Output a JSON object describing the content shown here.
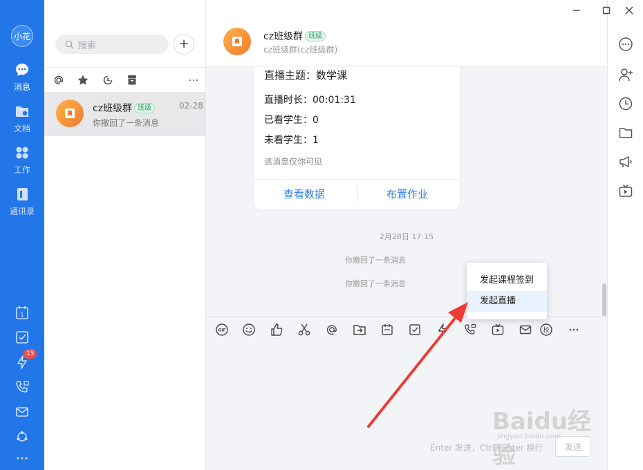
{
  "window": {
    "controls": [
      "minimize",
      "maximize",
      "close"
    ]
  },
  "nav": {
    "avatar_text": "小花",
    "items": [
      {
        "label": "消息",
        "icon": "message-icon",
        "active": true
      },
      {
        "label": "文档",
        "icon": "document-icon"
      },
      {
        "label": "工作",
        "icon": "work-icon"
      },
      {
        "label": "通讯录",
        "icon": "contacts-icon"
      }
    ],
    "bottom_icons": [
      "calendar-icon",
      "task-icon",
      "lightning-icon",
      "call-icon",
      "mail-icon",
      "network-icon",
      "more-icon"
    ],
    "badge": "15"
  },
  "list": {
    "search_placeholder": "搜索",
    "add_label": "+",
    "filter_icons": [
      "at-icon",
      "star-icon",
      "history-icon",
      "archive-icon",
      "more-icon"
    ],
    "conversation": {
      "name": "cz班级群",
      "tag": "班级",
      "time": "02-28",
      "last_message": "你撤回了一条消息"
    }
  },
  "chat": {
    "title": "cz班级群",
    "tag": "班级",
    "subtitle": "cz班级群(cz班级群)",
    "card": {
      "topic": "直播主题：数学课",
      "duration": "直播时长：00:01:31",
      "watched": "已看学生：0",
      "unwatched": "未看学生：1",
      "note": "该消息仅你可见",
      "btn_data": "查看数据",
      "btn_homework": "布置作业"
    },
    "timestamp": "2月28日 17:15",
    "system_messages": [
      "你撤回了一条消息",
      "你撤回了一条消息"
    ],
    "toolbar_icons": [
      "gif-icon",
      "emoji-icon",
      "thumbs-up-icon",
      "scissors-icon",
      "at-icon",
      "folder-send-icon",
      "calendar-icon",
      "check-icon",
      "lightning-icon",
      "call-icon",
      "live-icon",
      "mail-icon",
      "school-icon",
      "more-icon"
    ],
    "input_hint": "Enter 发送，Ctrl+Enter 换行",
    "send_label": "发送"
  },
  "popup": {
    "items": [
      "发起课程签到",
      "发起直播"
    ],
    "highlighted": "发起直播"
  },
  "right_icons": [
    "more-icon",
    "add-member-icon",
    "history-icon",
    "folder-icon",
    "announcement-icon",
    "live-icon"
  ],
  "watermark": {
    "text": "Baidu经验",
    "sub": "jingyan.baidu.com"
  },
  "colors": {
    "nav_bg": "#2376e8",
    "accent": "#2f7fe0",
    "arrow": "#ee3b33",
    "badge": "#f04c4c"
  }
}
